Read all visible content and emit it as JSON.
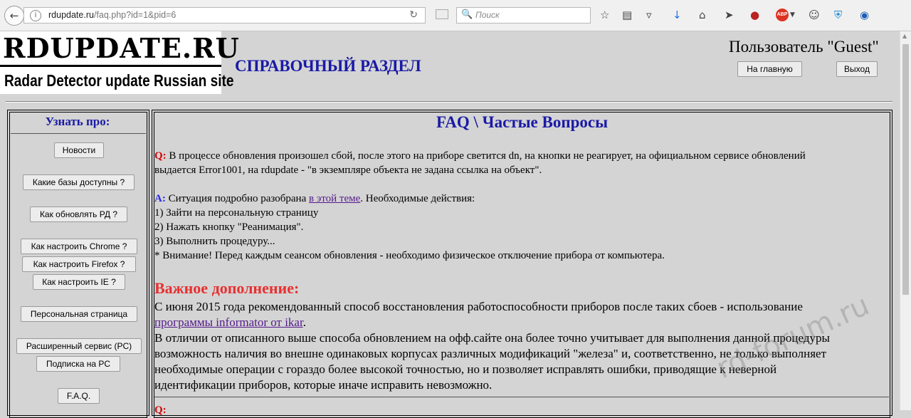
{
  "browser": {
    "url_host": "rdupdate.ru",
    "url_path": "/faq.php?id=1&pid=6",
    "search_placeholder": "Поиск",
    "adblock_label": "ABP"
  },
  "header": {
    "logo_top": "RDUPDATE.RU",
    "logo_sub": "Radar Detector update Russian site",
    "section_title": "СПРАВОЧНЫЙ РАЗДЕЛ",
    "user_label": "Пользователь \"Guest\"",
    "home_button": "На главную",
    "logout_button": "Выход"
  },
  "sidebar": {
    "title": "Узнать про:",
    "items": [
      "Новости",
      "Какие базы доступны ?",
      "Как обновлять РД ?",
      "Как настроить Chrome ?",
      "Как настроить Firefox ?",
      "Как настроить IE ?",
      "Персональная страница",
      "Расширенный сервис (PC)",
      "Подписка на PC",
      "F.A.Q."
    ]
  },
  "faq": {
    "title": "FAQ \\ Частые Вопросы",
    "q_mark": "Q:",
    "q_line1": " В процессе обновления произошел сбой, после этого на приборе светится dn, на кнопки не реагирует, на официальном сервисе обновлений",
    "q_line2": "выдается Error1001, на rdupdate - \"в экземпляре объекта не задана ссылка на объект\".",
    "a_mark": "A:",
    "a_intro": " Ситуация подробно разобрана ",
    "a_link": "в этой теме",
    "a_after": ". Необходимые действия:",
    "steps": [
      "1) Зайти на персональную страницу",
      "2) Нажать кнопку \"Реанимация\".",
      "3) Выполнить процедуру...",
      "* Внимание! Перед каждым сеансом обновления - необходимо физическое отключение прибора от компьютера."
    ],
    "important_title": "Важное дополнение:",
    "imp_line1": "С июня 2015 года рекомендованный способ восстановления работоспособности приборов после таких сбоев - использование",
    "imp_link": "программы informator от ikar",
    "imp_link_after": ".",
    "imp_lines": [
      "В отличии от описанного выше способа обновлением на офф.сайте она более точно учитывает для выполнения данной процедуры",
      "возможность наличия во внешне одинаковых корпусах различных модификаций \"железа\" и, соответственно, не только выполняет",
      "необходимые операции с гораздо более высокой точностью, но и позволяет исправлять ошибки, приводящие к неверной",
      "идентификации приборов, которые иначе исправить невозможно."
    ],
    "next_q_mark": "Q:"
  },
  "watermark": "rd-forum.ru"
}
